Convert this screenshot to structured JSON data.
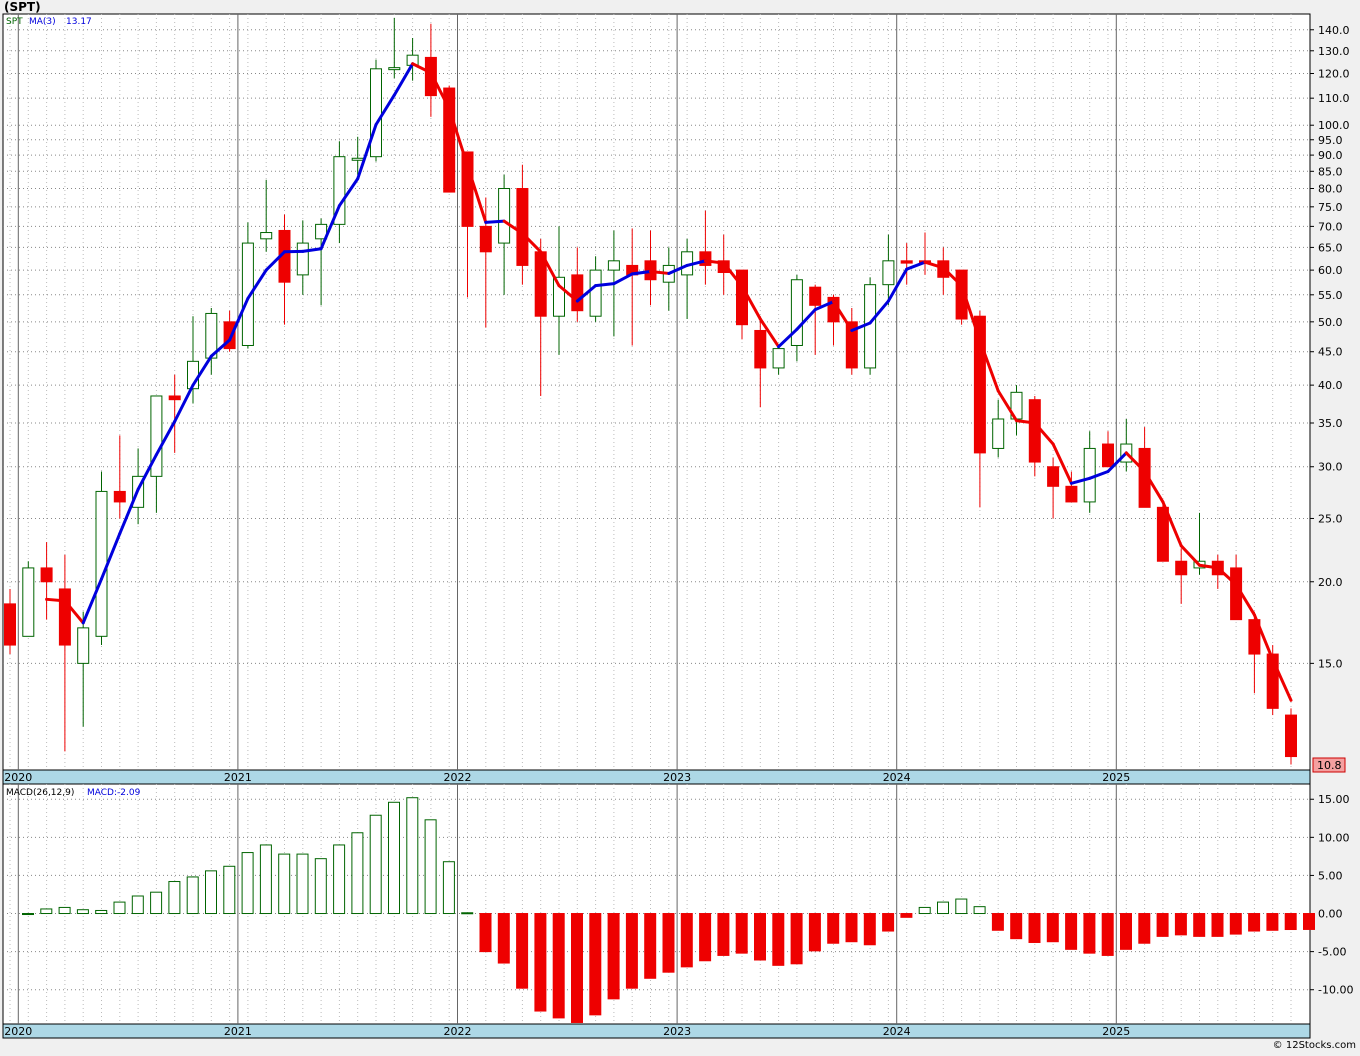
{
  "header": {
    "title": "(SPT)"
  },
  "footer": {
    "credit": "© 12Stocks.com"
  },
  "price_panel": {
    "symbol": "SPT",
    "ma_label": "MA(3)",
    "ma_value": "13.17",
    "last_price": "10.8"
  },
  "macd_panel": {
    "label": "MACD(26,12,9)",
    "value_label": "MACD:-2.09"
  },
  "colors": {
    "up": "#006400",
    "down": "#ee0000",
    "ma_up": "#0000dd",
    "ma_down": "#ee0000",
    "axis_band": "#add8e6",
    "grid": "#888888",
    "background": "#ffffff"
  },
  "chart_data": [
    {
      "type": "candlestick",
      "title": "(SPT)",
      "scale": "log",
      "ylim": [
        10.3,
        148
      ],
      "y_ticks": [
        140,
        130,
        120,
        110,
        100,
        95,
        90,
        85,
        80,
        75,
        70,
        65,
        60,
        55,
        50,
        45,
        40,
        35,
        30,
        25,
        20,
        15
      ],
      "y_tick_labels": [
        "140.0",
        "130.0",
        "120.0",
        "110.0",
        "100.0",
        "95.0",
        "90.0",
        "85.0",
        "80.0",
        "75.0",
        "70.0",
        "65.0",
        "60.0",
        "55.0",
        "50.0",
        "45.0",
        "40.0",
        "35.0",
        "30.0",
        "25.0",
        "20.0",
        "15.0"
      ],
      "x_labels": [
        "2020",
        "2021",
        "2022",
        "2023",
        "2024",
        "2025"
      ],
      "x_start": "2019-12",
      "grid": true,
      "series": [
        {
          "name": "SPT",
          "ohlc": [
            [
              18.5,
              19.5,
              15.5,
              16
            ],
            [
              16.5,
              21.5,
              16.5,
              21
            ],
            [
              21,
              23,
              17.5,
              20
            ],
            [
              19.5,
              22,
              11,
              16
            ],
            [
              15,
              18,
              12,
              17
            ],
            [
              16.5,
              29.5,
              16,
              27.5
            ],
            [
              27.5,
              33.5,
              25,
              26.5
            ],
            [
              26,
              32,
              24.5,
              29
            ],
            [
              29,
              38.5,
              25.5,
              38.5
            ],
            [
              38.5,
              41.5,
              31.5,
              38
            ],
            [
              39.5,
              51,
              37.5,
              43.5
            ],
            [
              44,
              52.5,
              41.5,
              51.5
            ],
            [
              50,
              52,
              45,
              45.5
            ],
            [
              46,
              71,
              45.5,
              66
            ],
            [
              67,
              82.5,
              64,
              68.5
            ],
            [
              69,
              73,
              49.5,
              57.5
            ],
            [
              59,
              71.5,
              55,
              66
            ],
            [
              67,
              72,
              53,
              70.5
            ],
            [
              70.5,
              94.5,
              66,
              89.5
            ],
            [
              89,
              96,
              84,
              89
            ],
            [
              89.5,
              126,
              88,
              122
            ],
            [
              122,
              146,
              118,
              122.5
            ],
            [
              123.5,
              136,
              117,
              128
            ],
            [
              127,
              143,
              103,
              111
            ],
            [
              114,
              115,
              80,
              79
            ],
            [
              91,
              91,
              54.5,
              70
            ],
            [
              70,
              77.5,
              49,
              64
            ],
            [
              66,
              84,
              55,
              80
            ],
            [
              80,
              87,
              57,
              61
            ],
            [
              64,
              67,
              38.5,
              51
            ],
            [
              51,
              70,
              44.5,
              58.5
            ],
            [
              59,
              65,
              50,
              52
            ],
            [
              51,
              63,
              50,
              60
            ],
            [
              60,
              69,
              47.5,
              62
            ],
            [
              61,
              69.5,
              46,
              59
            ],
            [
              62,
              69,
              53,
              58
            ],
            [
              57.5,
              65,
              52,
              61
            ],
            [
              59,
              67,
              50.5,
              64
            ],
            [
              64,
              74,
              57,
              61
            ],
            [
              62,
              68,
              55,
              59.5
            ],
            [
              60,
              60,
              47,
              49.5
            ],
            [
              48.5,
              51,
              37,
              42.5
            ],
            [
              42.5,
              46,
              41.5,
              45.5
            ],
            [
              46,
              59,
              43.5,
              58
            ],
            [
              56.5,
              57,
              44.5,
              53
            ],
            [
              54.5,
              55,
              46,
              50
            ],
            [
              50,
              52.5,
              41.5,
              42.5
            ],
            [
              42.5,
              58.5,
              41.5,
              57
            ],
            [
              57,
              68,
              53,
              62
            ],
            [
              62,
              66,
              57,
              61.5
            ],
            [
              62,
              68.5,
              59,
              61.5
            ],
            [
              62,
              65,
              55,
              58.5
            ],
            [
              60,
              60,
              49.5,
              50.5
            ],
            [
              51,
              52,
              26,
              31.5
            ],
            [
              32,
              38,
              31,
              35.5
            ],
            [
              35.5,
              40,
              33.5,
              39
            ],
            [
              38,
              38.5,
              29,
              30.5
            ],
            [
              30,
              31,
              25,
              28
            ],
            [
              28,
              29.5,
              26.5,
              26.5
            ],
            [
              26.5,
              34,
              25.5,
              32
            ],
            [
              32.5,
              34,
              30,
              30
            ],
            [
              30.5,
              35.5,
              29.5,
              32.5
            ],
            [
              32,
              34.5,
              26,
              26
            ],
            [
              26,
              26.5,
              21.5,
              21.5
            ],
            [
              21.5,
              22.5,
              18.5,
              20.5
            ],
            [
              21,
              25.5,
              20.5,
              21.5
            ],
            [
              21.5,
              22,
              19.5,
              20.5
            ],
            [
              21,
              22,
              18,
              17.5
            ],
            [
              17.5,
              18,
              13.5,
              15.5
            ],
            [
              15.5,
              16,
              12.5,
              12.8
            ],
            [
              12.5,
              12.8,
              10.5,
              10.8
            ]
          ]
        },
        {
          "name": "MA(3)",
          "values": [
            null,
            null,
            18.8,
            18.7,
            17.3,
            20.2,
            23.7,
            27.7,
            31.3,
            35.2,
            40.0,
            44.3,
            46.9,
            54.3,
            60.0,
            64.0,
            64.1,
            64.7,
            75.3,
            82.8,
            100.2,
            111.2,
            124.2,
            120.3,
            106.0,
            86.7,
            71.0,
            71.3,
            68.3,
            64.0,
            56.8,
            53.8,
            56.8,
            57.2,
            59.2,
            59.7,
            59.3,
            61.0,
            62.0,
            61.5,
            56.7,
            50.5,
            45.8,
            48.7,
            52.2,
            53.7,
            48.5,
            49.8,
            53.8,
            60.2,
            61.7,
            60.5,
            56.8,
            46.8,
            39.2,
            35.3,
            35.0,
            32.5,
            28.3,
            28.8,
            29.5,
            31.5,
            29.5,
            26.5,
            22.7,
            21.2,
            21.0,
            19.8,
            17.8,
            15.2,
            13.17
          ]
        }
      ]
    },
    {
      "type": "bar",
      "title": "MACD(26,12,9)",
      "ylim": [
        -14.5,
        17
      ],
      "y_ticks": [
        15,
        10,
        5,
        0,
        -5,
        -10
      ],
      "y_tick_labels": [
        "15.00",
        "10.00",
        "5.00",
        "0.00",
        "-5.00",
        "-10.00"
      ],
      "x_labels": [
        "2020",
        "2021",
        "2022",
        "2023",
        "2024",
        "2025"
      ],
      "series": [
        {
          "name": "MACD",
          "values": [
            0,
            0.6,
            0.8,
            0.5,
            0.4,
            1.5,
            2.3,
            2.8,
            4.2,
            4.8,
            5.6,
            6.2,
            8,
            9,
            7.8,
            7.8,
            7.2,
            9,
            10.6,
            12.9,
            14.6,
            15.2,
            12.3,
            6.8,
            0.1,
            -5,
            -6.5,
            -9.8,
            -12.8,
            -13.7,
            -14.3,
            -13.3,
            -11.2,
            -9.8,
            -8.5,
            -7.7,
            -7,
            -6.2,
            -5.5,
            -5.2,
            -6.1,
            -6.8,
            -6.6,
            -4.9,
            -3.9,
            -3.7,
            -4.1,
            -2.3,
            -0.5,
            0.8,
            1.5,
            1.9,
            0.9,
            -2.2,
            -3.3,
            -3.8,
            -3.7,
            -4.7,
            -5.2,
            -5.5,
            -4.7,
            -3.9,
            -3,
            -2.8,
            -3,
            -3,
            -2.7,
            -2.3,
            -2.2,
            -2.1,
            -2.09
          ]
        }
      ]
    }
  ]
}
